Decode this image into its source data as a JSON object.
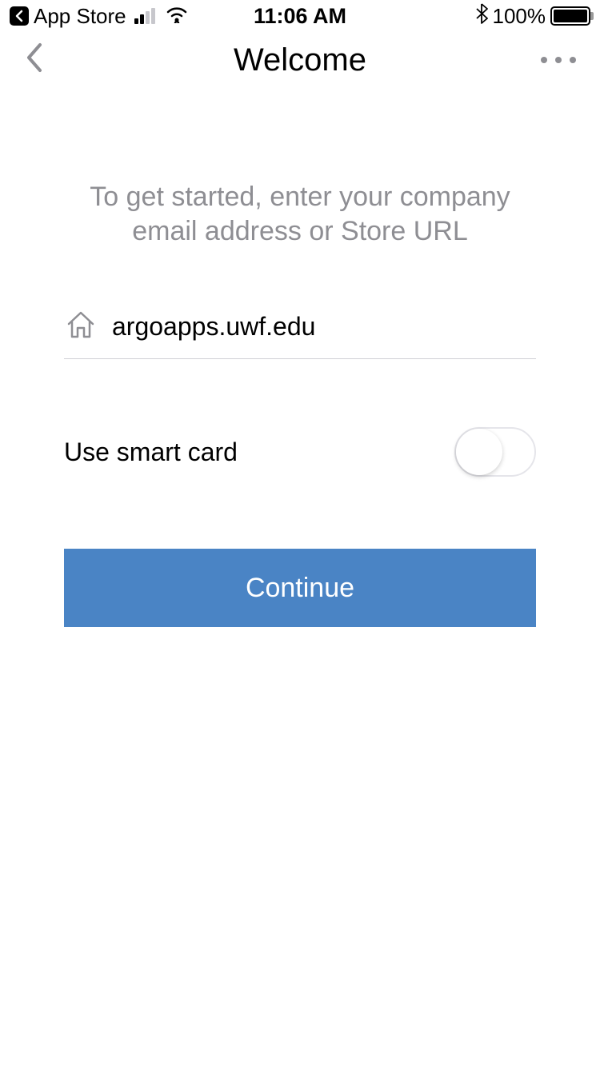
{
  "statusBar": {
    "backApp": "App Store",
    "time": "11:06 AM",
    "batteryText": "100%"
  },
  "nav": {
    "title": "Welcome"
  },
  "main": {
    "instruction": "To get started, enter your company email address or Store URL",
    "urlValue": "argoapps.uwf.edu",
    "smartCardLabel": "Use smart card",
    "continueLabel": "Continue"
  }
}
